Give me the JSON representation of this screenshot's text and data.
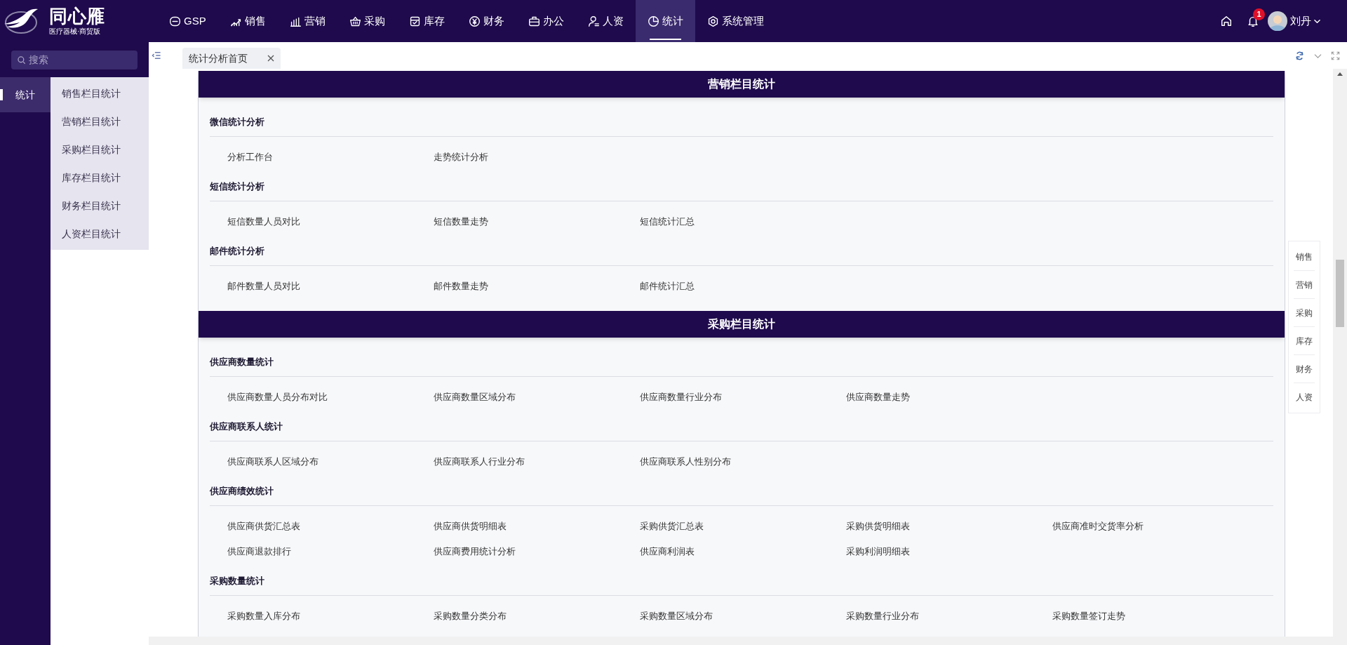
{
  "logo": {
    "name": "同心雁",
    "subtitle": "医疗器械·商贸版"
  },
  "nav": [
    {
      "label": "GSP",
      "selected": false
    },
    {
      "label": "销售",
      "selected": false
    },
    {
      "label": "营销",
      "selected": false
    },
    {
      "label": "采购",
      "selected": false
    },
    {
      "label": "库存",
      "selected": false
    },
    {
      "label": "财务",
      "selected": false
    },
    {
      "label": "办公",
      "selected": false
    },
    {
      "label": "人资",
      "selected": false
    },
    {
      "label": "统计",
      "selected": true
    },
    {
      "label": "系统管理",
      "selected": false
    }
  ],
  "user": {
    "name": "刘丹",
    "notifications": "1"
  },
  "sidebar": {
    "search_placeholder": "搜索",
    "items": [
      {
        "label": "统计",
        "selected": true
      }
    ],
    "submenu": [
      "销售栏目统计",
      "营销栏目统计",
      "采购栏目统计",
      "库存栏目统计",
      "财务栏目统计",
      "人资栏目统计"
    ]
  },
  "tabs": [
    {
      "label": "统计分析首页",
      "selected": true
    }
  ],
  "sections": [
    {
      "title": "营销栏目统计",
      "groups": [
        {
          "title": "微信统计分析",
          "items": [
            "分析工作台",
            "走势统计分析"
          ]
        },
        {
          "title": "短信统计分析",
          "items": [
            "短信数量人员对比",
            "短信数量走势",
            "短信统计汇总"
          ]
        },
        {
          "title": "邮件统计分析",
          "items": [
            "邮件数量人员对比",
            "邮件数量走势",
            "邮件统计汇总"
          ]
        }
      ]
    },
    {
      "title": "采购栏目统计",
      "groups": [
        {
          "title": "供应商数量统计",
          "items": [
            "供应商数量人员分布对比",
            "供应商数量区域分布",
            "供应商数量行业分布",
            "供应商数量走势"
          ]
        },
        {
          "title": "供应商联系人统计",
          "items": [
            "供应商联系人区域分布",
            "供应商联系人行业分布",
            "供应商联系人性别分布"
          ]
        },
        {
          "title": "供应商绩效统计",
          "items": [
            "供应商供货汇总表",
            "供应商供货明细表",
            "采购供货汇总表",
            "采购供货明细表",
            "供应商准时交货率分析",
            "供应商退款排行",
            "供应商费用统计分析",
            "供应商利润表",
            "采购利润明细表"
          ]
        },
        {
          "title": "采购数量统计",
          "items": [
            "采购数量入库分布",
            "采购数量分类分布",
            "采购数量区域分布",
            "采购数量行业分布",
            "采购数量签订走势"
          ]
        }
      ]
    }
  ],
  "quick_nav": [
    "销售",
    "营销",
    "采购",
    "库存",
    "财务",
    "人资"
  ]
}
